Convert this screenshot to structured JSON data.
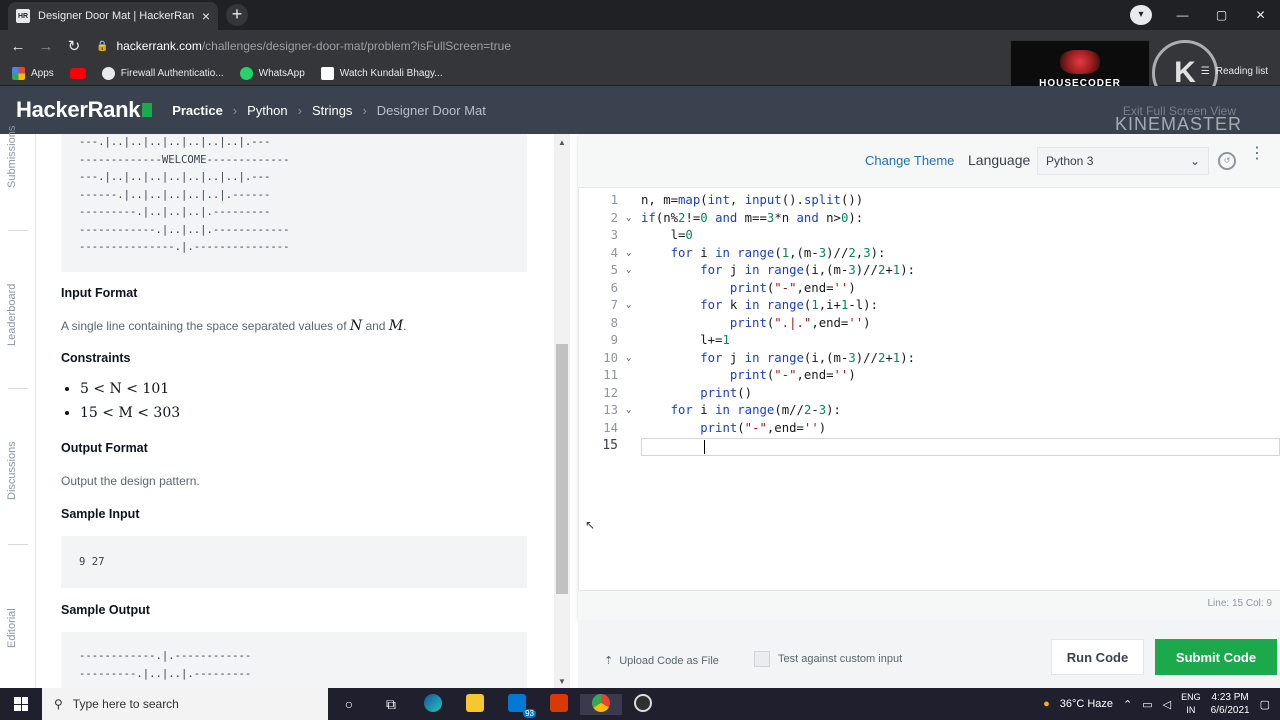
{
  "browser": {
    "tab_title": "Designer Door Mat | HackerRank",
    "tab_favicon": "HR",
    "new_tab": "+",
    "url_host": "hackerrank.com",
    "url_path": "/challenges/designer-door-mat/problem?isFullScreen=true",
    "reading_list": "Reading list"
  },
  "bookmarks": [
    {
      "label": "Apps",
      "icon": "apps-icon"
    },
    {
      "label": "",
      "icon": "youtube-icon"
    },
    {
      "label": "Firewall Authenticatio...",
      "icon": "globe-icon"
    },
    {
      "label": "WhatsApp",
      "icon": "whatsapp-icon"
    },
    {
      "label": "Watch Kundali Bhagy...",
      "icon": "site-icon"
    }
  ],
  "overlay": {
    "housecoder": "_HOUSECODER_",
    "kine_logo": "K",
    "kinemaster": "KINEMASTER",
    "exit_fullscreen": "Exit Full Screen View"
  },
  "hackerrank": {
    "logo": "HackerRank",
    "breadcrumb": [
      "Practice",
      "Python",
      "Strings",
      "Designer Door Mat"
    ]
  },
  "sidebar": [
    "Submissions",
    "Leaderboard",
    "Discussions",
    "Editorial"
  ],
  "problem": {
    "pattern_top": "---.|..|..|..|..|..|..|..|.---\n-------------WELCOME-------------\n---.|..|..|..|..|..|..|..|.---\n------.|..|..|..|..|..|.------\n---------.|..|..|..|.---------\n------------.|..|..|.------------\n---------------.|.---------------",
    "input_format_h": "Input Format",
    "input_format_pre": "A single line containing the space separated values of ",
    "var_n": "N",
    "and": " and ",
    "var_m": "M",
    "period": ".",
    "constraints_h": "Constraints",
    "constraints": [
      "5 < N < 101",
      "15 < M < 303"
    ],
    "output_format_h": "Output Format",
    "output_format": "Output the design pattern.",
    "sample_input_h": "Sample Input",
    "sample_input": "9 27",
    "sample_output_h": "Sample Output",
    "sample_output": "------------.|.------------\n---------.|..|..|.---------"
  },
  "editor": {
    "change_theme": "Change Theme",
    "language_label": "Language",
    "language": "Python 3",
    "status": "Line: 15 Col: 9",
    "lines": [
      {
        "n": "1",
        "fold": "",
        "code": "n, m=map(int, input().split())"
      },
      {
        "n": "2",
        "fold": "v",
        "code": "if(n%2!=0 and m==3*n and n>0):"
      },
      {
        "n": "3",
        "fold": "",
        "code": "    l=0"
      },
      {
        "n": "4",
        "fold": "v",
        "code": "    for i in range(1,(m-3)//2,3):"
      },
      {
        "n": "5",
        "fold": "v",
        "code": "        for j in range(i,(m-3)//2+1):"
      },
      {
        "n": "6",
        "fold": "",
        "code": "            print(\"-\",end='')"
      },
      {
        "n": "7",
        "fold": "v",
        "code": "        for k in range(1,i+1-l):"
      },
      {
        "n": "8",
        "fold": "",
        "code": "            print(\".|.\",end='')"
      },
      {
        "n": "9",
        "fold": "",
        "code": "        l+=1"
      },
      {
        "n": "10",
        "fold": "v",
        "code": "        for j in range(i,(m-3)//2+1):"
      },
      {
        "n": "11",
        "fold": "",
        "code": "            print(\"-\",end='')"
      },
      {
        "n": "12",
        "fold": "",
        "code": "        print()"
      },
      {
        "n": "13",
        "fold": "v",
        "code": "    for i in range(m//2-3):"
      },
      {
        "n": "14",
        "fold": "",
        "code": "        print(\"-\",end='')"
      },
      {
        "n": "15",
        "fold": "",
        "code": ""
      }
    ]
  },
  "actions": {
    "upload": "Upload Code as File",
    "custom_input": "Test against custom input",
    "run": "Run Code",
    "submit": "Submit Code"
  },
  "taskbar": {
    "search_placeholder": "Type here to search",
    "weather": "36°C  Haze",
    "lang1": "ENG",
    "lang2": "IN",
    "time": "4:23 PM",
    "date": "6/6/2021",
    "mail_badge": "93"
  },
  "colors": {
    "hr_header": "#39424e",
    "submit_green": "#1ba94c",
    "link_blue": "#1d72b8",
    "keyword_blue": "#1d3fbf",
    "string_red": "#a31515",
    "number_green": "#098658"
  }
}
